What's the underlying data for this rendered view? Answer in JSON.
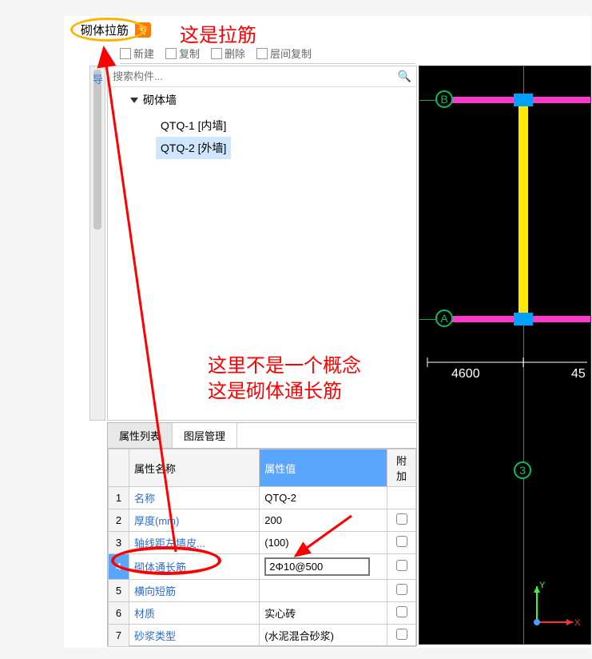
{
  "top_tag": {
    "label": "砌体拉筋",
    "badge": "专"
  },
  "annotations": {
    "a1": "这是拉筋",
    "a2_line1": "这里不是一个概念",
    "a2_line2": "这是砌体通长筋"
  },
  "toolbar": {
    "new_label": "新建",
    "copy_label": "复制",
    "delete_label": "删除",
    "between_label": "层间复制"
  },
  "search": {
    "placeholder": "搜索构件..."
  },
  "tree": {
    "root": "砌体墙",
    "items": [
      {
        "label": "QTQ-1 [内墙]",
        "selected": false
      },
      {
        "label": "QTQ-2 [外墙]",
        "selected": true
      }
    ]
  },
  "leftbar_text": "导",
  "prop_tabs": {
    "tab1": "属性列表",
    "tab2": "图层管理"
  },
  "prop_headers": {
    "name": "属性名称",
    "value": "属性值",
    "extra": "附加"
  },
  "prop_rows": [
    {
      "n": "1",
      "name": "名称",
      "value": "QTQ-2",
      "link": true,
      "chk": false
    },
    {
      "n": "2",
      "name": "厚度(mm)",
      "value": "200",
      "link": true,
      "chk": true
    },
    {
      "n": "3",
      "name": "轴线距左墙皮...",
      "value": "(100)",
      "link": true,
      "chk": true
    },
    {
      "n": "4",
      "name": "砌体通长筋",
      "value": "2Φ10@500",
      "link": true,
      "chk": true,
      "editing": true,
      "selected": true
    },
    {
      "n": "5",
      "name": "横向短筋",
      "value": "",
      "link": true,
      "chk": true
    },
    {
      "n": "6",
      "name": "材质",
      "value": "实心砖",
      "link": true,
      "chk": true
    },
    {
      "n": "7",
      "name": "砂浆类型",
      "value": "(水泥混合砂浆)",
      "link": true,
      "chk": true
    }
  ],
  "viewport": {
    "axis_labels": {
      "a": "A",
      "b": "B",
      "col3": "3"
    },
    "dims": {
      "d1": "4600",
      "d2": "45"
    },
    "axis3d": {
      "x": "X",
      "y": "Y"
    }
  }
}
